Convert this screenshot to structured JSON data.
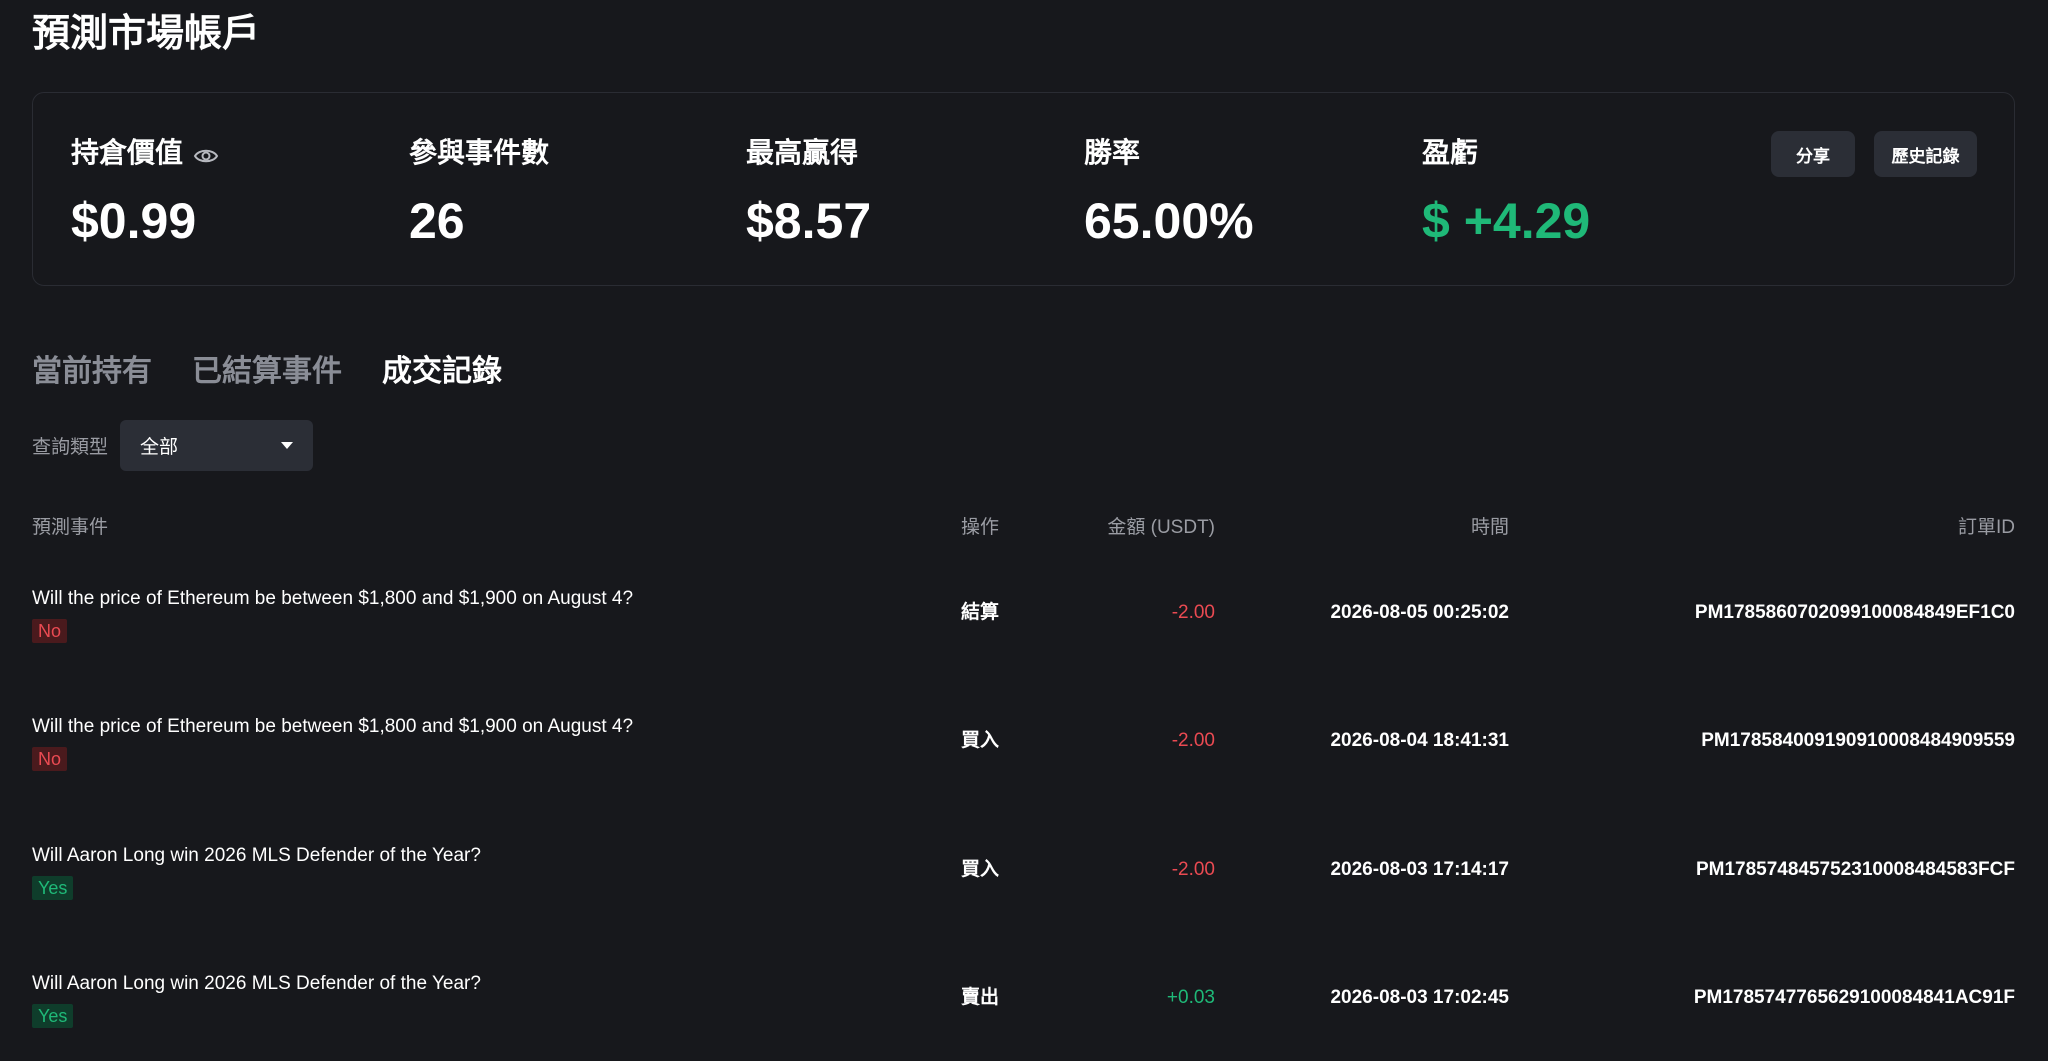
{
  "page": {
    "title": "預測市場帳戶"
  },
  "summary": {
    "position_value": {
      "label": "持倉價值",
      "value": "$0.99"
    },
    "events_count": {
      "label": "參與事件數",
      "value": "26"
    },
    "max_win": {
      "label": "最高贏得",
      "value": "$8.57"
    },
    "win_rate": {
      "label": "勝率",
      "value": "65.00%"
    },
    "pnl": {
      "label": "盈虧",
      "value": "$ +4.29"
    },
    "share_label": "分享",
    "history_label": "歷史記錄"
  },
  "tabs": [
    {
      "label": "當前持有",
      "active": false
    },
    {
      "label": "已結算事件",
      "active": false
    },
    {
      "label": "成交記錄",
      "active": true
    }
  ],
  "filter": {
    "label": "查詢類型",
    "selected": "全部"
  },
  "table": {
    "headers": {
      "event": "預測事件",
      "operation": "操作",
      "amount": "金額 (USDT)",
      "time": "時間",
      "order_id": "訂單ID"
    },
    "rows": [
      {
        "event": "Will the price of Ethereum be between $1,800 and $1,900 on August 4?",
        "outcome": "No",
        "operation": "結算",
        "amount": "-2.00",
        "time": "2026-08-05 00:25:02",
        "order_id": "PM178586070209910008484 9EF1C0"
      },
      {
        "event": "Will the price of Ethereum be between $1,800 and $1,900 on August 4?",
        "outcome": "No",
        "operation": "買入",
        "amount": "-2.00",
        "time": "2026-08-04 18:41:31",
        "order_id": "PM1785840091909100084849 09559"
      },
      {
        "event": "Will Aaron Long win 2026 MLS Defender of the Year?",
        "outcome": "Yes",
        "operation": "買入",
        "amount": "-2.00",
        "time": "2026-08-03 17:14:17",
        "order_id": "PM1785748457523100084845 83FCF"
      },
      {
        "event": "Will Aaron Long win 2026 MLS Defender of the Year?",
        "outcome": "Yes",
        "operation": "賣出",
        "amount": "+0.03",
        "time": "2026-08-03 17:02:45",
        "order_id": "PM17857477656291000848 41AC91F"
      }
    ]
  },
  "colors": {
    "background": "#17181c",
    "positive": "#1fb978",
    "negative": "#ea4a52",
    "button_bg": "#2b2e36",
    "muted_text": "#9a9ca3"
  }
}
